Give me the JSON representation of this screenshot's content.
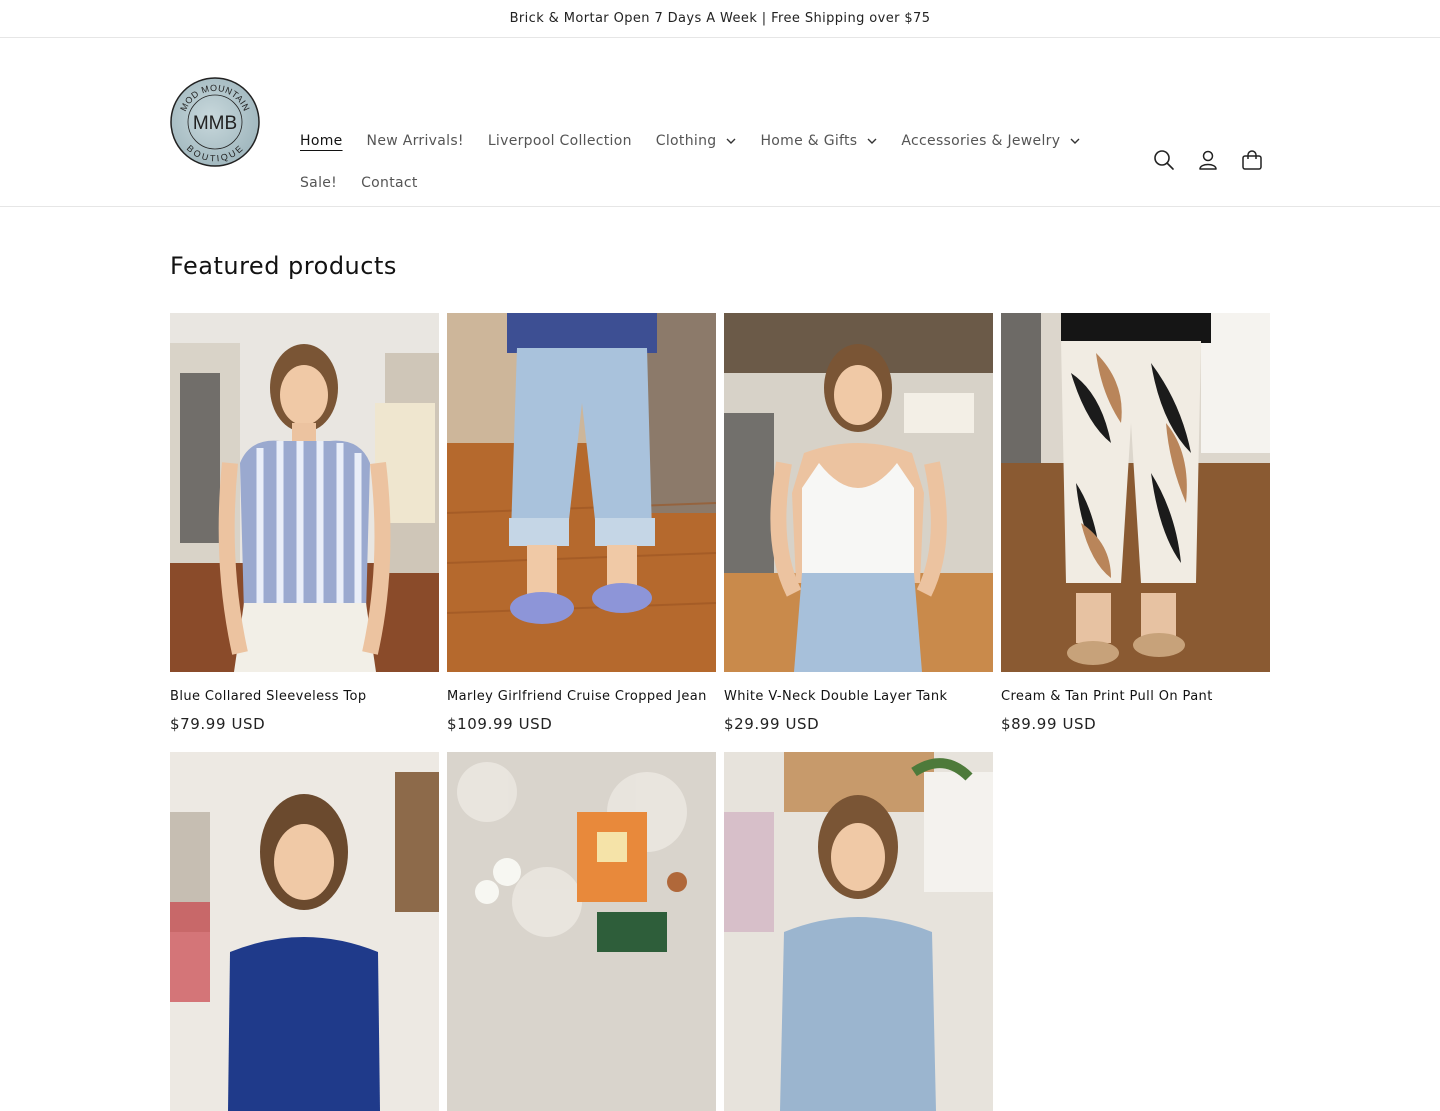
{
  "announcement": "Brick & Mortar Open 7 Days A Week | Free Shipping over $75",
  "logo": {
    "line1": "MOD MOUNTAIN",
    "initials": "MMB",
    "line2": "BOUTIQUE"
  },
  "nav": [
    {
      "label": "Home",
      "dropdown": false,
      "active": true
    },
    {
      "label": "New Arrivals!",
      "dropdown": false
    },
    {
      "label": "Liverpool Collection",
      "dropdown": false
    },
    {
      "label": "Clothing",
      "dropdown": true
    },
    {
      "label": "Home & Gifts",
      "dropdown": true
    },
    {
      "label": "Accessories & Jewelry",
      "dropdown": true
    },
    {
      "label": "Sale!",
      "dropdown": false
    },
    {
      "label": "Contact",
      "dropdown": false
    }
  ],
  "icons": [
    "search-icon",
    "account-icon",
    "cart-icon"
  ],
  "section_title": "Featured products",
  "products": [
    {
      "title": "Blue Collared Sleeveless Top",
      "price": "$79.99 USD"
    },
    {
      "title": "Marley Girlfriend Cruise Cropped Jean",
      "price": "$109.99 USD"
    },
    {
      "title": "White V-Neck Double Layer Tank",
      "price": "$29.99 USD"
    },
    {
      "title": "Cream & Tan Print Pull On Pant",
      "price": "$89.99 USD"
    },
    {
      "title": "",
      "price": ""
    },
    {
      "title": "",
      "price": ""
    },
    {
      "title": "",
      "price": ""
    }
  ],
  "colors": {
    "text": "#121212",
    "muted": "#555555",
    "border": "#e6e6e6",
    "logo_bg": "#a9bfc6"
  }
}
